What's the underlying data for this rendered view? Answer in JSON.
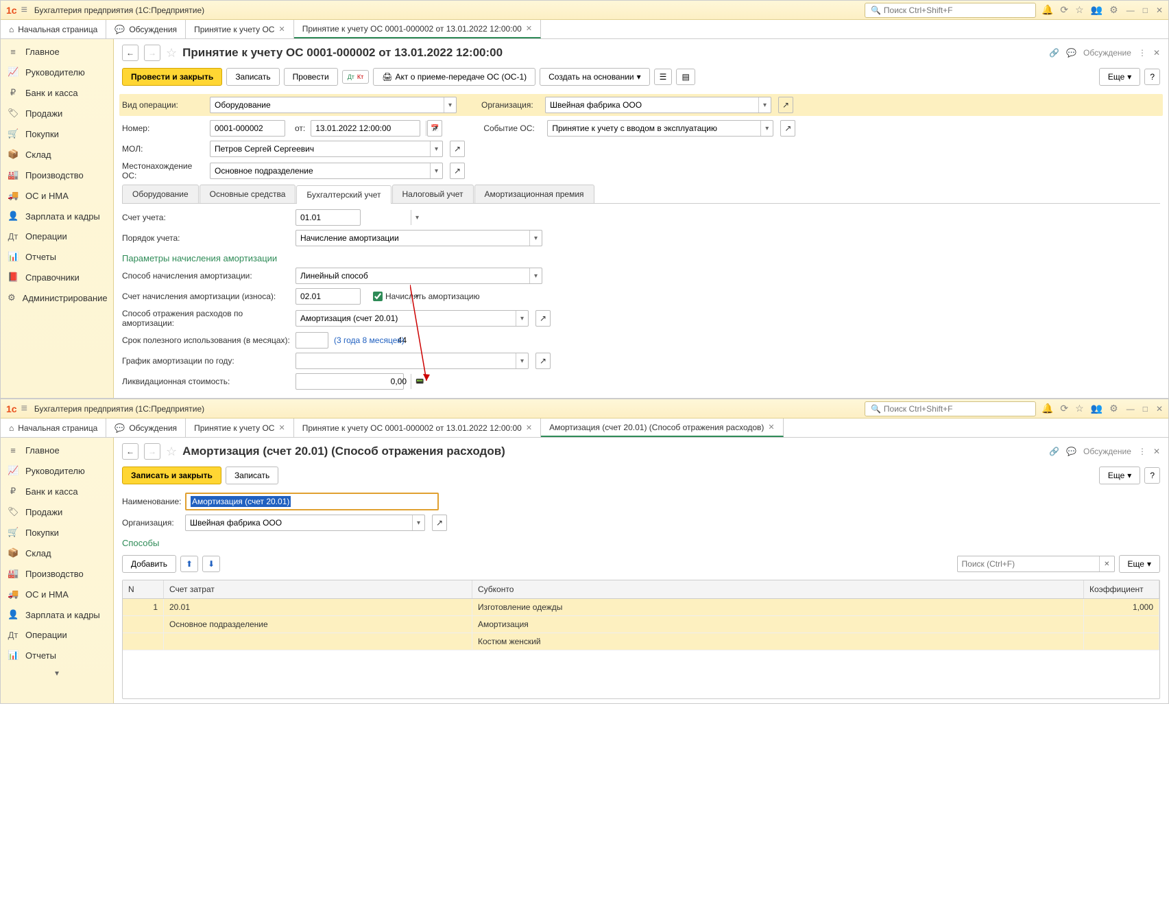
{
  "app_title": "Бухгалтерия предприятия  (1С:Предприятие)",
  "search_placeholder": "Поиск Ctrl+Shift+F",
  "tabs_top": {
    "home": "Начальная страница",
    "discuss": "Обсуждения",
    "tab1": "Принятие к учету ОС",
    "tab2": "Принятие к учету ОС 0001-000002 от 13.01.2022 12:00:00",
    "tab3": "Амортизация (счет 20.01) (Способ отражения расходов)"
  },
  "sidebar": [
    {
      "icon": "≡",
      "label": "Главное"
    },
    {
      "icon": "📈",
      "label": "Руководителю"
    },
    {
      "icon": "₽",
      "label": "Банк и касса"
    },
    {
      "icon": "🏷",
      "label": "Продажи"
    },
    {
      "icon": "🛒",
      "label": "Покупки"
    },
    {
      "icon": "📦",
      "label": "Склад"
    },
    {
      "icon": "🏭",
      "label": "Производство"
    },
    {
      "icon": "🚚",
      "label": "ОС и НМА"
    },
    {
      "icon": "👤",
      "label": "Зарплата и кадры"
    },
    {
      "icon": "Дт",
      "label": "Операции"
    },
    {
      "icon": "📊",
      "label": "Отчеты"
    },
    {
      "icon": "📕",
      "label": "Справочники"
    },
    {
      "icon": "⚙",
      "label": "Администрирование"
    }
  ],
  "doc1": {
    "title": "Принятие к учету ОС 0001-000002 от 13.01.2022 12:00:00",
    "discuss": "Обсуждение",
    "btn_post_close": "Провести и закрыть",
    "btn_save": "Записать",
    "btn_post": "Провести",
    "btn_act": "Акт о приеме-передаче ОС (ОС-1)",
    "btn_create_based": "Создать на основании",
    "btn_more": "Еще",
    "labels": {
      "oper_type": "Вид операции:",
      "org": "Организация:",
      "num": "Номер:",
      "from": "от:",
      "event": "Событие ОС:",
      "mol": "МОЛ:",
      "location": "Местонахождение ОС:"
    },
    "values": {
      "oper_type": "Оборудование",
      "org": "Швейная фабрика ООО",
      "num": "0001-000002",
      "date": "13.01.2022 12:00:00",
      "event": "Принятие к учету с вводом в эксплуатацию",
      "mol": "Петров Сергей Сергеевич",
      "location": "Основное подразделение"
    },
    "subtabs": [
      "Оборудование",
      "Основные средства",
      "Бухгалтерский учет",
      "Налоговый учет",
      "Амортизационная премия"
    ],
    "acc": {
      "account_label": "Счет учета:",
      "account": "01.01",
      "order_label": "Порядок учета:",
      "order": "Начисление амортизации",
      "section": "Параметры начисления амортизации",
      "method_label": "Способ начисления амортизации:",
      "method": "Линейный способ",
      "depr_acc_label": "Счет начисления амортизации (износа):",
      "depr_acc": "02.01",
      "calc_depr": "Начислять амортизацию",
      "expense_label": "Способ отражения расходов по амортизации:",
      "expense": "Амортизация (счет 20.01)",
      "life_label": "Срок полезного использования (в месяцах):",
      "life": "44",
      "life_note": "(3 года 8 месяцев)",
      "schedule_label": "График амортизации по году:",
      "liquid_label": "Ликвидационная стоимость:",
      "liquid": "0,00"
    }
  },
  "doc2": {
    "title": "Амортизация (счет 20.01) (Способ отражения расходов)",
    "discuss": "Обсуждение",
    "btn_save_close": "Записать и закрыть",
    "btn_save": "Записать",
    "btn_more": "Еще",
    "name_label": "Наименование:",
    "name_value": "Амортизация (счет 20.01)",
    "org_label": "Организация:",
    "org_value": "Швейная фабрика ООО",
    "section": "Способы",
    "btn_add": "Добавить",
    "search_ph": "Поиск (Ctrl+F)",
    "columns": {
      "n": "N",
      "acc": "Счет затрат",
      "sub": "Субконто",
      "coef": "Коэффициент"
    },
    "rows": {
      "n": "1",
      "acc": "20.01",
      "sub1": "Изготовление одежды",
      "coef": "1,000",
      "acc2": "Основное подразделение",
      "sub2": "Амортизация",
      "sub3": "Костюм женский"
    }
  }
}
